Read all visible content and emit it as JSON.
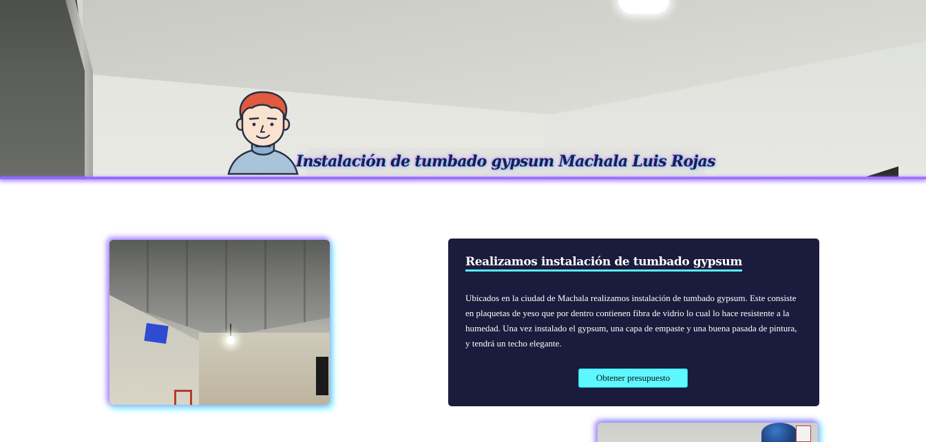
{
  "hero": {
    "title": "Instalación de tumbado gypsum Machala Luis Rojas",
    "background": "photo-of-white-gypsum-ceiling-room",
    "avatar_icon": "avatar-icon",
    "accent_line_color": "#9c72ff"
  },
  "featured": {
    "image": "photo-of-gypsum-ceiling-installation",
    "title": "Realizamos instalación de tumbado gypsum",
    "description": "Ubicados en la ciudad de Machala realizamos instalación de tumbado gypsum. Este consiste en plaquetas de yeso que por dentro contienen fibra de vidrio lo cual lo hace resistente a la humedad. Una vez instalado el gypsum, una capa de empaste y una buena pasada de pintura, y tendrá un techo elegante.",
    "cta_label": "Obtener presupuesto",
    "card_color": "#1b1b3d",
    "cta_color": "#5ef6ff",
    "underline_color": "#56f5ff"
  },
  "second_photo": {
    "image": "photo-of-room-ceiling"
  }
}
